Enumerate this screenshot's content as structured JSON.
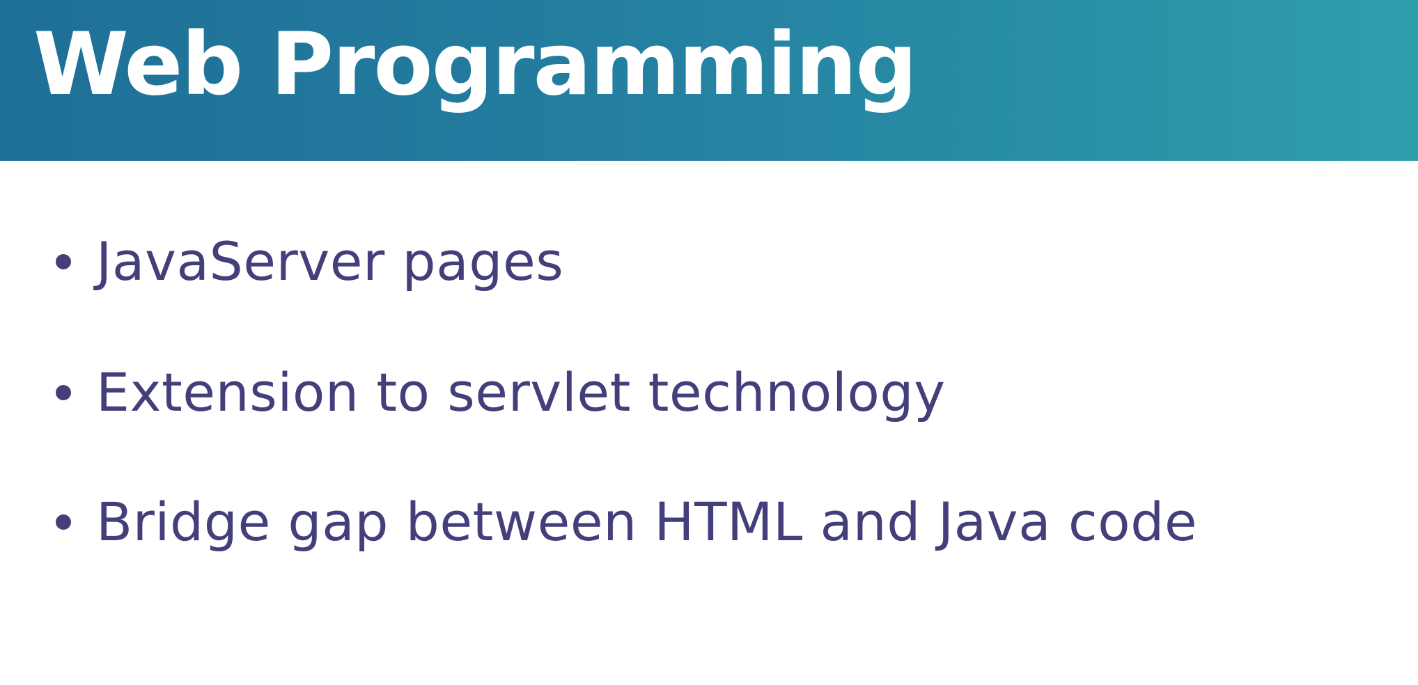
{
  "slide": {
    "title": "Web Programming",
    "bullets": [
      "JavaServer pages",
      "Extension to servlet technology",
      "Bridge gap between HTML and Java code"
    ]
  },
  "colors": {
    "header_start": "#1e6f97",
    "header_end": "#2f9eac",
    "title_text": "#ffffff",
    "body_text": "#433f7a",
    "background": "#ffffff"
  }
}
